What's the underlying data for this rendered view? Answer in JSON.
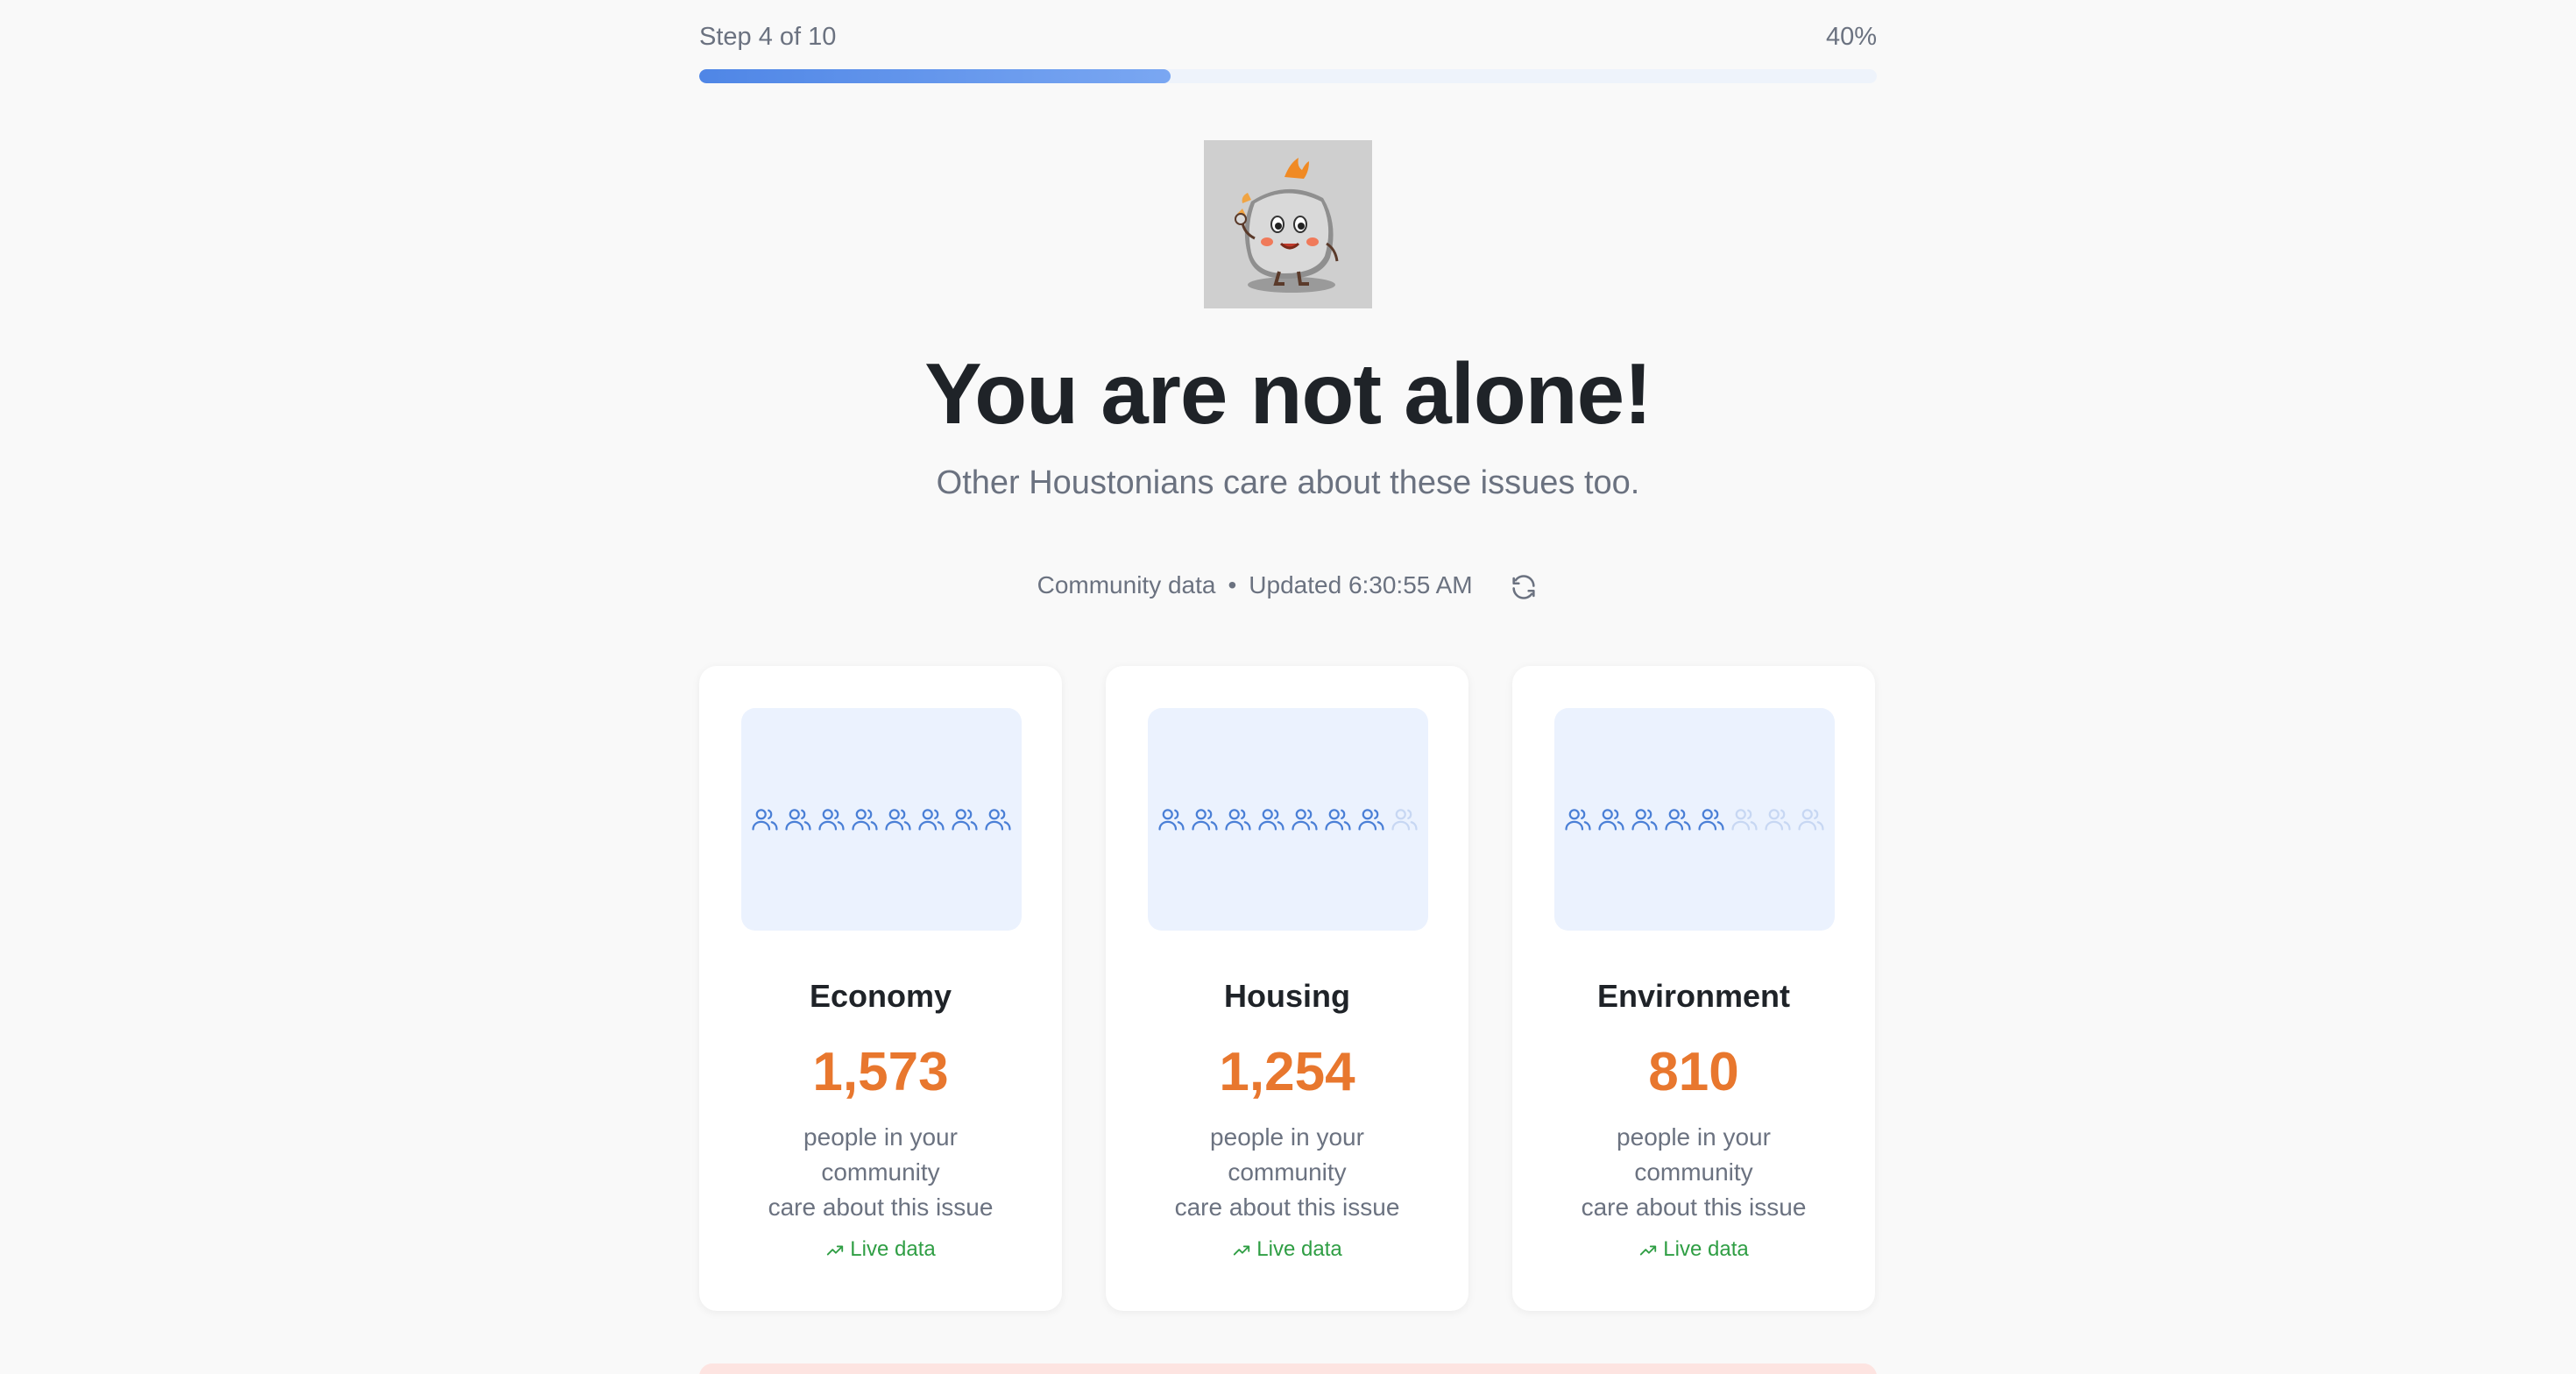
{
  "progress": {
    "step_label": "Step 4 of 10",
    "percent_label": "40%",
    "fraction": 0.4,
    "fill_color": "#4f86e6"
  },
  "hero": {
    "mascot": "rock-mascot-illustration",
    "title": "You are not alone!",
    "subtitle": "Other Houstonians care about these issues too."
  },
  "meta": {
    "source": "Community data",
    "separator": "•",
    "updated": "Updated 6:30:55 AM",
    "refresh_icon": "refresh-icon"
  },
  "cards": [
    {
      "label": "Economy",
      "count": "1,573",
      "desc_line1": "people in your",
      "desc_line2": "community",
      "desc_line3": "care about this issue",
      "live": "Live data",
      "icons_active": 8,
      "icons_total": 8
    },
    {
      "label": "Housing",
      "count": "1,254",
      "desc_line1": "people in your",
      "desc_line2": "community",
      "desc_line3": "care about this issue",
      "live": "Live data",
      "icons_active": 7,
      "icons_total": 8
    },
    {
      "label": "Environment",
      "count": "810",
      "desc_line1": "people in your",
      "desc_line2": "community",
      "desc_line3": "care about this issue",
      "live": "Live data",
      "icons_active": 5,
      "icons_total": 8
    }
  ],
  "colors": {
    "accent_orange": "#e8772e",
    "live_green": "#2f9e44",
    "icon_blue": "#4a7fd6",
    "icon_faded": "#c7d7f3"
  }
}
